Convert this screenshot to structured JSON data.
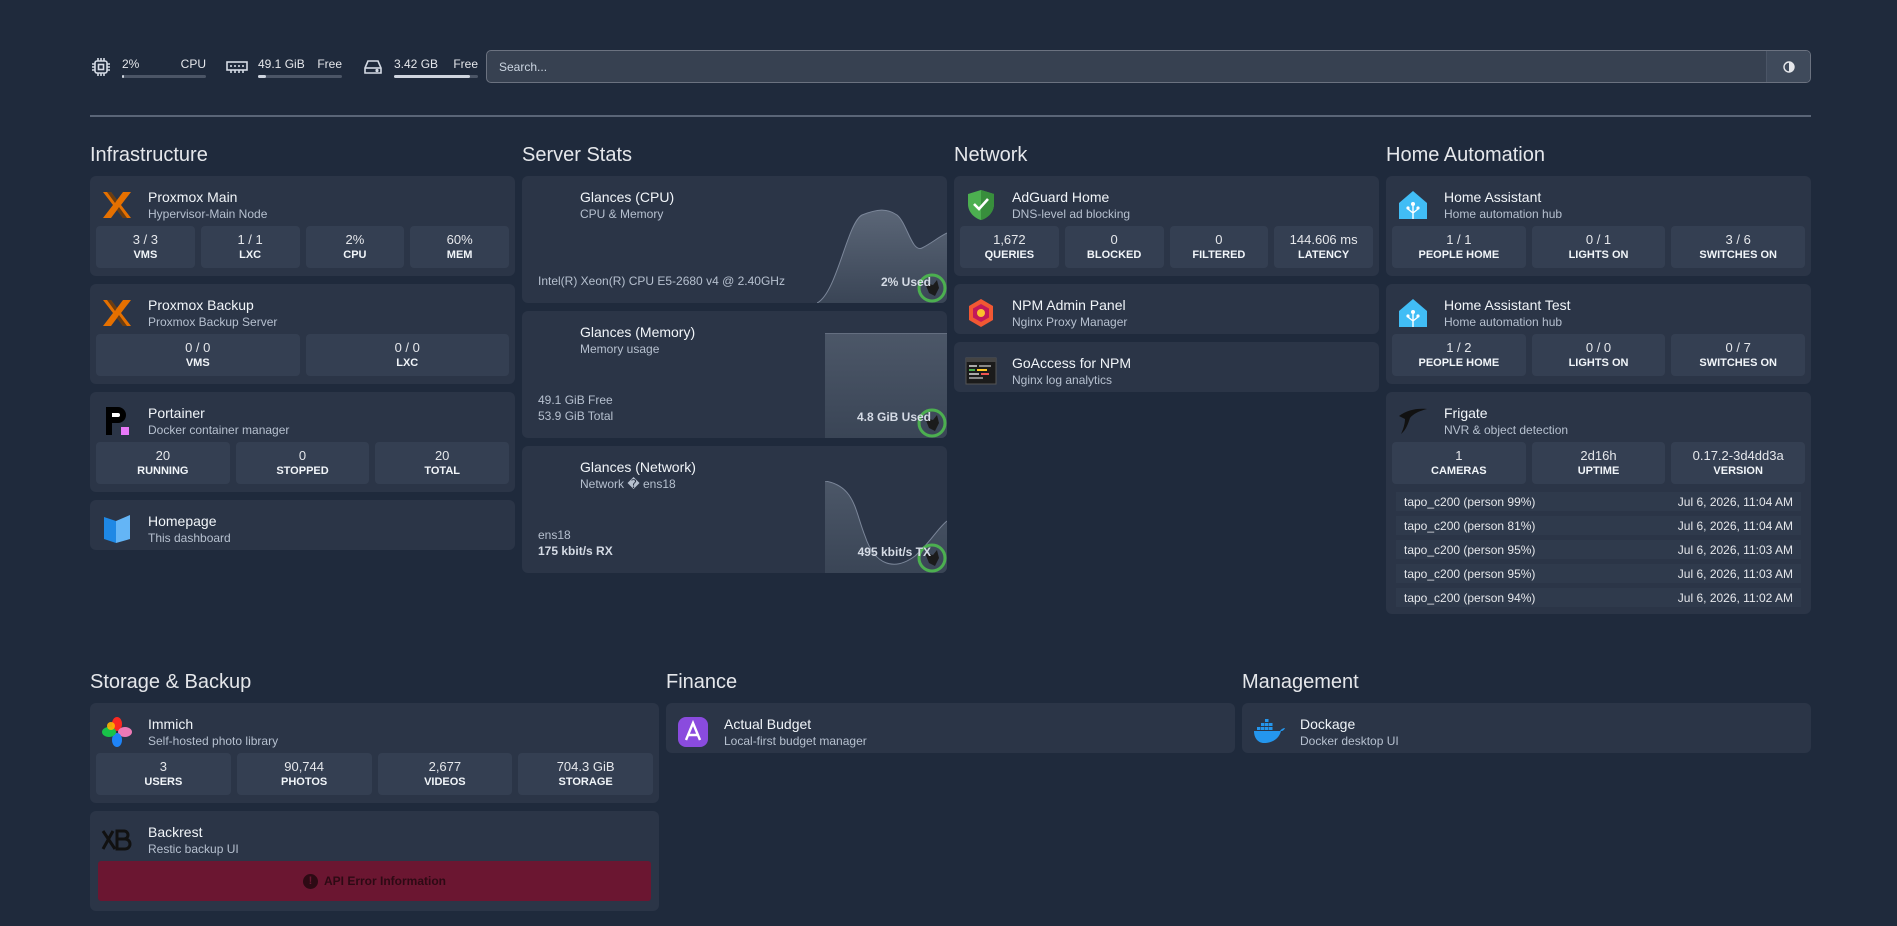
{
  "topbar": {
    "cpu": {
      "value": "2%",
      "label": "CPU",
      "level": 0.02
    },
    "ram": {
      "value": "49.1 GiB",
      "label": "Free",
      "level": 0.09
    },
    "disk": {
      "value": "3.42 GB",
      "label": "Free",
      "level": 0.9
    },
    "search_placeholder": "Search..."
  },
  "infrastructure": {
    "title": "Infrastructure",
    "proxmox_main": {
      "name": "Proxmox Main",
      "desc": "Hypervisor-Main Node",
      "stats": [
        {
          "v": "3 / 3",
          "l": "VMS"
        },
        {
          "v": "1 / 1",
          "l": "LXC"
        },
        {
          "v": "2%",
          "l": "CPU"
        },
        {
          "v": "60%",
          "l": "MEM"
        }
      ]
    },
    "proxmox_backup": {
      "name": "Proxmox Backup",
      "desc": "Proxmox Backup Server",
      "stats": [
        {
          "v": "0 / 0",
          "l": "VMS"
        },
        {
          "v": "0 / 0",
          "l": "LXC"
        }
      ]
    },
    "portainer": {
      "name": "Portainer",
      "desc": "Docker container manager",
      "stats": [
        {
          "v": "20",
          "l": "RUNNING"
        },
        {
          "v": "0",
          "l": "STOPPED"
        },
        {
          "v": "20",
          "l": "TOTAL"
        }
      ]
    },
    "homepage": {
      "name": "Homepage",
      "desc": "This dashboard"
    }
  },
  "server_stats": {
    "title": "Server Stats",
    "cpu": {
      "name": "Glances (CPU)",
      "desc": "CPU & Memory",
      "foot": "Intel(R) Xeon(R) CPU E5-2680 v4 @ 2.40GHz",
      "right": "2% Used"
    },
    "mem": {
      "name": "Glances (Memory)",
      "desc": "Memory usage",
      "foot1": "49.1 GiB Free",
      "foot2": "53.9 GiB Total",
      "right": "4.8 GiB Used"
    },
    "net": {
      "name": "Glances (Network)",
      "desc": "Network � ens18",
      "foot1": "ens18",
      "foot2": "175 kbit/s RX",
      "right": "495 kbit/s TX"
    }
  },
  "network": {
    "title": "Network",
    "adguard": {
      "name": "AdGuard Home",
      "desc": "DNS-level ad blocking",
      "stats": [
        {
          "v": "1,672",
          "l": "QUERIES"
        },
        {
          "v": "0",
          "l": "BLOCKED"
        },
        {
          "v": "0",
          "l": "FILTERED"
        },
        {
          "v": "144.606 ms",
          "l": "LATENCY"
        }
      ]
    },
    "npm": {
      "name": "NPM Admin Panel",
      "desc": "Nginx Proxy Manager"
    },
    "goaccess": {
      "name": "GoAccess for NPM",
      "desc": "Nginx log analytics"
    }
  },
  "home_automation": {
    "title": "Home Automation",
    "ha": {
      "name": "Home Assistant",
      "desc": "Home automation hub",
      "stats": [
        {
          "v": "1 / 1",
          "l": "PEOPLE HOME"
        },
        {
          "v": "0 / 1",
          "l": "LIGHTS ON"
        },
        {
          "v": "3 / 6",
          "l": "SWITCHES ON"
        }
      ]
    },
    "ha_test": {
      "name": "Home Assistant Test",
      "desc": "Home automation hub",
      "stats": [
        {
          "v": "1 / 2",
          "l": "PEOPLE HOME"
        },
        {
          "v": "0 / 0",
          "l": "LIGHTS ON"
        },
        {
          "v": "0 / 7",
          "l": "SWITCHES ON"
        }
      ]
    },
    "frigate": {
      "name": "Frigate",
      "desc": "NVR & object detection",
      "stats": [
        {
          "v": "1",
          "l": "CAMERAS"
        },
        {
          "v": "2d16h",
          "l": "UPTIME"
        },
        {
          "v": "0.17.2-3d4dd3a",
          "l": "VERSION"
        }
      ],
      "events": [
        {
          "name": "tapo_c200 (person 99%)",
          "time": "Jul 6, 2026, 11:04 AM"
        },
        {
          "name": "tapo_c200 (person 81%)",
          "time": "Jul 6, 2026, 11:04 AM"
        },
        {
          "name": "tapo_c200 (person 95%)",
          "time": "Jul 6, 2026, 11:03 AM"
        },
        {
          "name": "tapo_c200 (person 95%)",
          "time": "Jul 6, 2026, 11:03 AM"
        },
        {
          "name": "tapo_c200 (person 94%)",
          "time": "Jul 6, 2026, 11:02 AM"
        }
      ]
    }
  },
  "storage": {
    "title": "Storage & Backup",
    "immich": {
      "name": "Immich",
      "desc": "Self-hosted photo library",
      "stats": [
        {
          "v": "3",
          "l": "USERS"
        },
        {
          "v": "90,744",
          "l": "PHOTOS"
        },
        {
          "v": "2,677",
          "l": "VIDEOS"
        },
        {
          "v": "704.3 GiB",
          "l": "STORAGE"
        }
      ]
    },
    "backrest": {
      "name": "Backrest",
      "desc": "Restic backup UI",
      "error": "API Error Information"
    }
  },
  "finance": {
    "title": "Finance",
    "actual": {
      "name": "Actual Budget",
      "desc": "Local-first budget manager"
    }
  },
  "management": {
    "title": "Management",
    "dockage": {
      "name": "Dockage",
      "desc": "Docker desktop UI"
    }
  }
}
